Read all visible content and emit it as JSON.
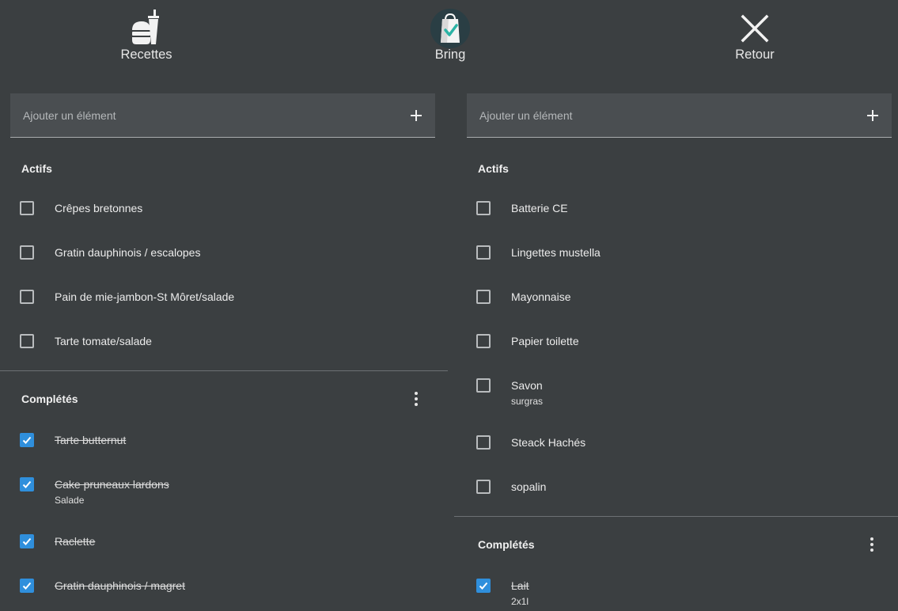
{
  "nav": {
    "recettes": "Recettes",
    "bring": "Bring",
    "retour": "Retour"
  },
  "left": {
    "add_placeholder": "Ajouter un élément",
    "active_title": "Actifs",
    "active": [
      {
        "label": "Crêpes bretonnes"
      },
      {
        "label": "Gratin dauphinois / escalopes"
      },
      {
        "label": "Pain de mie-jambon-St Môret/salade"
      },
      {
        "label": "Tarte tomate/salade"
      }
    ],
    "completed_title": "Complétés",
    "completed": [
      {
        "label": "Tarte butternut"
      },
      {
        "label": "Cake pruneaux lardons",
        "sub": "Salade"
      },
      {
        "label": "Raclette"
      },
      {
        "label": "Gratin dauphinois / magret"
      }
    ]
  },
  "right": {
    "add_placeholder": "Ajouter un élément",
    "active_title": "Actifs",
    "active": [
      {
        "label": "Batterie CE"
      },
      {
        "label": "Lingettes mustella"
      },
      {
        "label": "Mayonnaise"
      },
      {
        "label": "Papier toilette"
      },
      {
        "label": "Savon",
        "sub": "surgras"
      },
      {
        "label": "Steack Hachés"
      },
      {
        "label": "sopalin"
      }
    ],
    "completed_title": "Complétés",
    "completed": [
      {
        "label": "Lait",
        "sub": "2x1l"
      }
    ]
  },
  "colors": {
    "background": "#3b3f41",
    "input_bg": "#4a4e51",
    "check_accent": "#2f8fdc",
    "bring_teal": "#2bb3a5"
  }
}
